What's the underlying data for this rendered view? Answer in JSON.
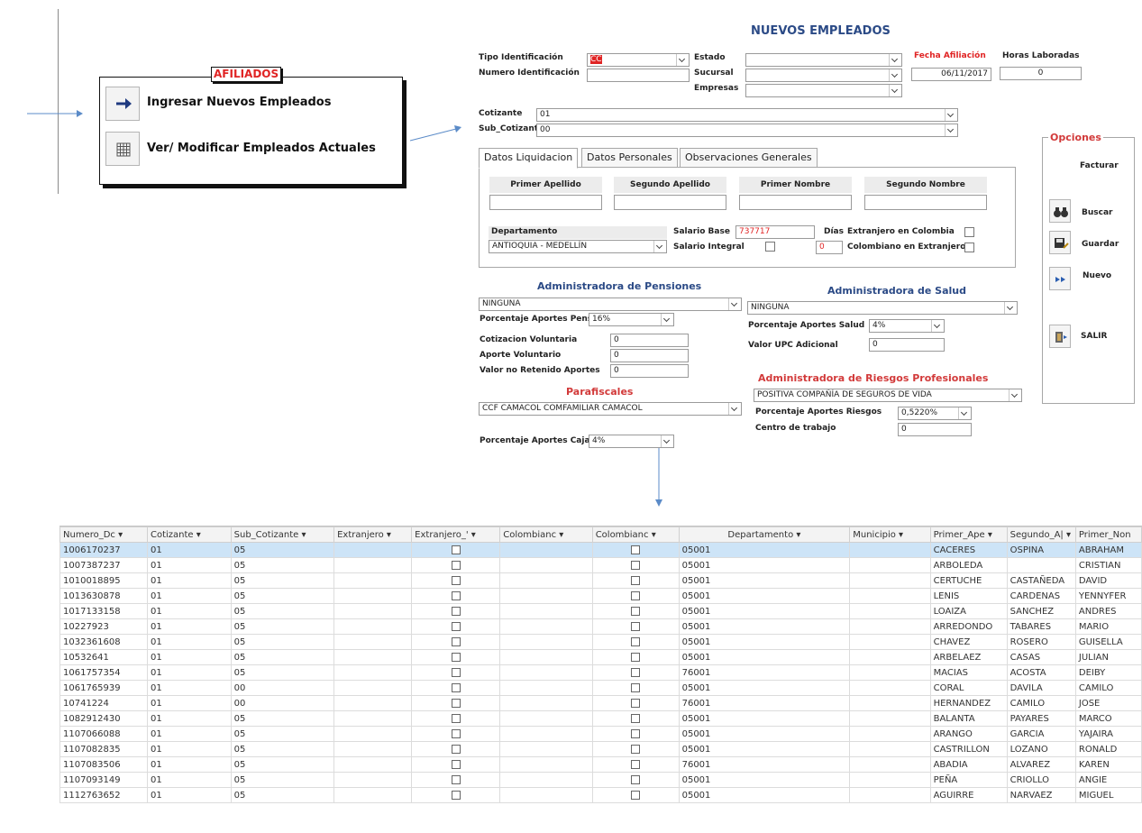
{
  "menu": {
    "title": "AFILIADOS",
    "items": [
      {
        "label": "Ingresar Nuevos Empleados",
        "icon": "arrow-right-icon"
      },
      {
        "label": "Ver/ Modificar Empleados Actuales",
        "icon": "grid-icon"
      }
    ]
  },
  "form": {
    "title": "NUEVOS EMPLEADOS",
    "tipo_identificacion": {
      "label": "Tipo Identificación",
      "value": "CC"
    },
    "numero_identificacion": {
      "label": "Numero Identificación",
      "value": ""
    },
    "estado": {
      "label": "Estado",
      "value": ""
    },
    "sucursal": {
      "label": "Sucursal",
      "value": ""
    },
    "empresas": {
      "label": "Empresas",
      "value": ""
    },
    "fecha_afiliacion": {
      "label": "Fecha Afiliación",
      "value": "06/11/2017"
    },
    "horas_laboradas": {
      "label": "Horas Laboradas",
      "value": "0"
    },
    "cotizante": {
      "label": "Cotizante",
      "value": "01"
    },
    "sub_cotizante": {
      "label": "Sub_Cotizante",
      "value": "00"
    }
  },
  "tabs": [
    {
      "label": "Datos Liquidacion"
    },
    {
      "label": "Datos Personales"
    },
    {
      "label": "Observaciones Generales"
    }
  ],
  "liquidacion": {
    "primer_apellido": "Primer Apellido",
    "segundo_apellido": "Segundo Apellido",
    "primer_nombre": "Primer Nombre",
    "segundo_nombre": "Segundo Nombre",
    "departamento": {
      "label": "Departamento",
      "value": "ANTIOQUIA - MEDELLÍN"
    },
    "salario_base": {
      "label": "Salario Base",
      "value": "737717"
    },
    "salario_integral": {
      "label": "Salario Integral"
    },
    "dias": {
      "label": "Días",
      "value": "0"
    },
    "extranjero_colombia": "Extranjero en Colombia",
    "colombiano_extranjero": "Colombiano en Extranjero"
  },
  "pensiones": {
    "title": "Administradora de Pensiones",
    "value": "NINGUNA",
    "porcentaje": {
      "label": "Porcentaje Aportes Pension",
      "value": "16%"
    },
    "cotizacion_voluntaria": {
      "label": "Cotizacion Voluntaria",
      "value": "0"
    },
    "aporte_voluntario": {
      "label": "Aporte Voluntario",
      "value": "0"
    },
    "valor_no_retenido": {
      "label": "Valor no Retenido Aportes",
      "value": "0"
    }
  },
  "parafiscales": {
    "title": "Parafiscales",
    "value": "CCF CAMACOL COMFAMILIAR CAMACOL",
    "porcentaje": {
      "label": "Porcentaje Aportes Caja",
      "value": "4%"
    }
  },
  "salud": {
    "title": "Administradora de Salud",
    "value": "NINGUNA",
    "porcentaje": {
      "label": "Porcentaje Aportes Salud",
      "value": "4%"
    },
    "upc": {
      "label": "Valor UPC Adicional",
      "value": "0"
    }
  },
  "riesgos": {
    "title": "Administradora de Riesgos Profesionales",
    "value": "POSITIVA COMPAÑÍA DE SEGUROS DE VIDA",
    "porcentaje": {
      "label": "Porcentaje Aportes Riesgos",
      "value": "0,5220%"
    },
    "centro": {
      "label": "Centro de trabajo",
      "value": "0"
    }
  },
  "opciones": {
    "title": "Opciones",
    "facturar": "Facturar",
    "buscar": "Buscar",
    "guardar": "Guardar",
    "nuevo": "Nuevo",
    "salir": "SALIR"
  },
  "table": {
    "columns": [
      "Numero_Dc ▾",
      "Cotizante ▾",
      "Sub_Cotizante ▾",
      "Extranjero ▾",
      "Extranjero_' ▾",
      "Colombianc ▾",
      "Colombianc ▾",
      "Departamento ▾",
      "Municipio ▾",
      "Primer_Ape ▾",
      "Segundo_A| ▾",
      "Primer_Non"
    ],
    "rows": [
      [
        "1006170237",
        "01",
        "05",
        "05001",
        "CACERES",
        "OSPINA",
        "ABRAHAM"
      ],
      [
        "1007387237",
        "01",
        "05",
        "05001",
        "ARBOLEDA",
        "",
        "CRISTIAN"
      ],
      [
        "1010018895",
        "01",
        "05",
        "05001",
        "CERTUCHE",
        "CASTAÑEDA",
        "DAVID"
      ],
      [
        "1013630878",
        "01",
        "05",
        "05001",
        "LENIS",
        "CARDENAS",
        "YENNYFER"
      ],
      [
        "1017133158",
        "01",
        "05",
        "05001",
        "LOAIZA",
        "SANCHEZ",
        "ANDRES"
      ],
      [
        "10227923",
        "01",
        "05",
        "05001",
        "ARREDONDO",
        "TABARES",
        "MARIO"
      ],
      [
        "1032361608",
        "01",
        "05",
        "05001",
        "CHAVEZ",
        "ROSERO",
        "GUISELLA"
      ],
      [
        "10532641",
        "01",
        "05",
        "05001",
        "ARBELAEZ",
        "CASAS",
        "JULIAN"
      ],
      [
        "1061757354",
        "01",
        "05",
        "76001",
        "MACIAS",
        "ACOSTA",
        "DEIBY"
      ],
      [
        "1061765939",
        "01",
        "00",
        "05001",
        "CORAL",
        "DAVILA",
        "CAMILO"
      ],
      [
        "10741224",
        "01",
        "00",
        "76001",
        "HERNANDEZ",
        "CAMILO",
        "JOSE"
      ],
      [
        "1082912430",
        "01",
        "05",
        "05001",
        "BALANTA",
        "PAYARES",
        "MARCO"
      ],
      [
        "1107066088",
        "01",
        "05",
        "05001",
        "ARANGO",
        "GARCIA",
        "YAJAIRA"
      ],
      [
        "1107082835",
        "01",
        "05",
        "05001",
        "CASTRILLON",
        "LOZANO",
        "RONALD"
      ],
      [
        "1107083506",
        "01",
        "05",
        "76001",
        "ABADIA",
        "ALVAREZ",
        "KAREN"
      ],
      [
        "1107093149",
        "01",
        "05",
        "05001",
        "PEÑA",
        "CRIOLLO",
        "ANGIE"
      ],
      [
        "1112763652",
        "01",
        "05",
        "05001",
        "AGUIRRE",
        "NARVAEZ",
        "MIGUEL"
      ]
    ]
  }
}
